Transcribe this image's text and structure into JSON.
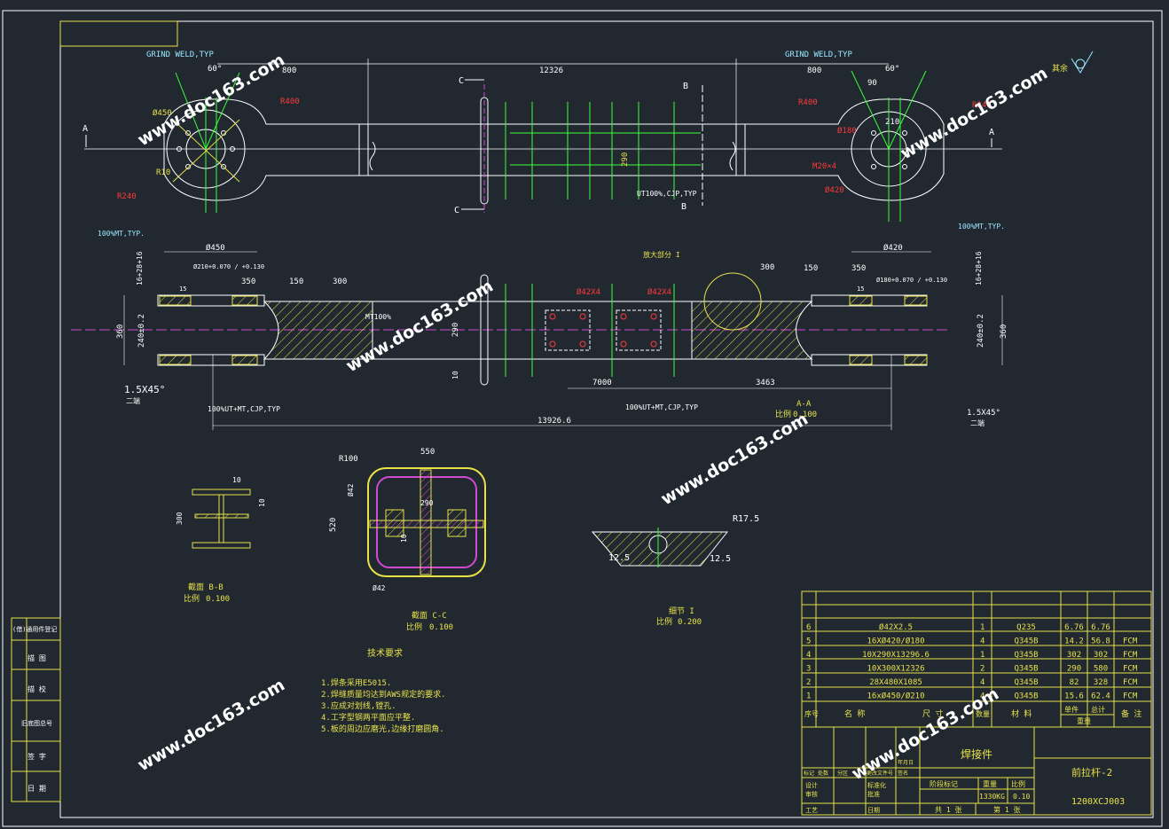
{
  "view_top": {
    "grind_weld_left": "GRIND WELD,TYP",
    "grind_weld_right": "GRIND WELD,TYP",
    "ut_label": "UT100%,CJP,TYP",
    "mt_left": "100%MT,TYP.",
    "mt_right": "100%MT,TYP.",
    "dims": {
      "d800_left": "800",
      "d12326": "12326",
      "d800_right": "800",
      "d60_left": "60°",
      "d60_right": "60°",
      "d90": "90",
      "d210": "210",
      "r400_left": "R400",
      "r400_right": "R400",
      "r240_left": "R240",
      "r240_right": "R240",
      "phi450": "Ø450",
      "r10": "R10",
      "phi180": "Ø180",
      "m20": "M20×4",
      "phi420": "Ø420",
      "h290": "290",
      "w8": "8",
      "w10": "10"
    },
    "sections": {
      "a": "A",
      "b": "B",
      "c": "C"
    },
    "finish": "其余"
  },
  "view_front": {
    "detail_ref": "放大部分 I",
    "d450": "Ø450",
    "d420": "Ø420",
    "d210_470": "Ø210+0.070 / +0.130",
    "d180_470": "Ø180+0.070 / +0.130",
    "d350_l": "350",
    "d150_l": "150",
    "d300_l": "300",
    "d300_r": "300",
    "d150_r": "150",
    "d350_r": "350",
    "d16_left": "16+28+16",
    "d16_right": "16+28+16",
    "d360_l": "360",
    "d240_l": "240±0.2",
    "d360_r": "360",
    "d240_r": "240±0.2",
    "d290": "290",
    "d10": "10",
    "phi42_l": "Ø42X4",
    "phi42_r": "Ø42X4",
    "mt100": "MT100%",
    "d7000": "7000",
    "d3463": "3463",
    "d13926": "13926.6",
    "chamfer_l": "1.5X45°",
    "chamfer_r": "1.5X45°",
    "chamfer_note_l": "二端",
    "chamfer_note_r": "二端",
    "weld_l": "100%UT+MT,CJP,TYP",
    "weld_r": "100%UT+MT,CJP,TYP",
    "sec_title": "A-A",
    "sec_scale_lbl": "比例",
    "sec_scale": "0.100",
    "d155_l": "15",
    "d155_r": "15"
  },
  "section_bb": {
    "d10a": "10",
    "d10b": "10",
    "d300": "300",
    "title": "截面 B-B",
    "scale_lbl": "比例",
    "scale": "0.100"
  },
  "section_cc": {
    "r100": "R100",
    "d550": "550",
    "d520": "520",
    "phi42a": "Ø42",
    "phi42b": "Ø42",
    "d290": "290",
    "d10": "10",
    "title": "截面 C-C",
    "scale_lbl": "比例",
    "scale": "0.100"
  },
  "detail_i": {
    "r175": "R17.5",
    "d125a": "12.5",
    "d125b": "12.5",
    "title": "细节 I",
    "scale_lbl": "比例",
    "scale": "0.200"
  },
  "tech": {
    "title": "技术要求",
    "items": [
      "1.焊条采用E5015.",
      "2.焊缝质量均达到AWS规定的要求.",
      "3.应成对划线,镗孔.",
      "4.工字型钢两平面应平整.",
      "5.板的周边应磨光,边缘打磨圆角."
    ]
  },
  "bom": {
    "rows": [
      {
        "no": "6",
        "spec": "Ø42X2.5",
        "qty": "1",
        "mat": "Q235",
        "w1": "6.76",
        "w2": "6.76",
        "note": ""
      },
      {
        "no": "5",
        "spec": "16XØ420/Ø180",
        "qty": "4",
        "mat": "Q345B",
        "w1": "14.2",
        "w2": "56.8",
        "note": "FCM"
      },
      {
        "no": "4",
        "spec": "10X290X13296.6",
        "qty": "1",
        "mat": "Q345B",
        "w1": "302",
        "w2": "302",
        "note": "FCM"
      },
      {
        "no": "3",
        "spec": "10X300X12326",
        "qty": "2",
        "mat": "Q345B",
        "w1": "290",
        "w2": "580",
        "note": "FCM"
      },
      {
        "no": "2",
        "spec": "28X480X1085",
        "qty": "4",
        "mat": "Q345B",
        "w1": "82",
        "w2": "328",
        "note": "FCM"
      },
      {
        "no": "1",
        "spec": "16xØ450/Ø210",
        "qty": "4",
        "mat": "Q345B",
        "w1": "15.6",
        "w2": "62.4",
        "note": "FCM"
      }
    ],
    "headers": {
      "no": "序号",
      "name": "名 称",
      "size": "尺 寸",
      "qty": "数量",
      "mat": "材 料",
      "single": "单件",
      "total": "总计",
      "weight": "重量",
      "note": "备 注"
    }
  },
  "title_block": {
    "type": "焊接件",
    "name": "前拉杆-2",
    "code": "1200XCJ003",
    "weight": "1330KG",
    "scale": "0.10",
    "weight_lbl": "重量",
    "scale_lbl": "比例",
    "stage_lbl": "阶段标记",
    "sheets": "共 1 张",
    "sheet": "第 1 张",
    "rows_left": [
      "标记",
      "处数",
      "分区",
      "更改文件号",
      "签名",
      "年月日"
    ],
    "roles": [
      "设计",
      "审核",
      "工艺"
    ],
    "roles2": [
      "标准化",
      "批准",
      "日期"
    ]
  },
  "side_panel": [
    "(借)通用件登记",
    "旧底图总号",
    "描 图",
    "描 校",
    "底图总号",
    "签 字",
    "日 期"
  ],
  "side_panel_order": [
    "(借)通用件登记",
    "描 图",
    "描 校",
    "旧底图总号",
    "签 字",
    "日 期"
  ],
  "watermark": "www.doc163.com"
}
